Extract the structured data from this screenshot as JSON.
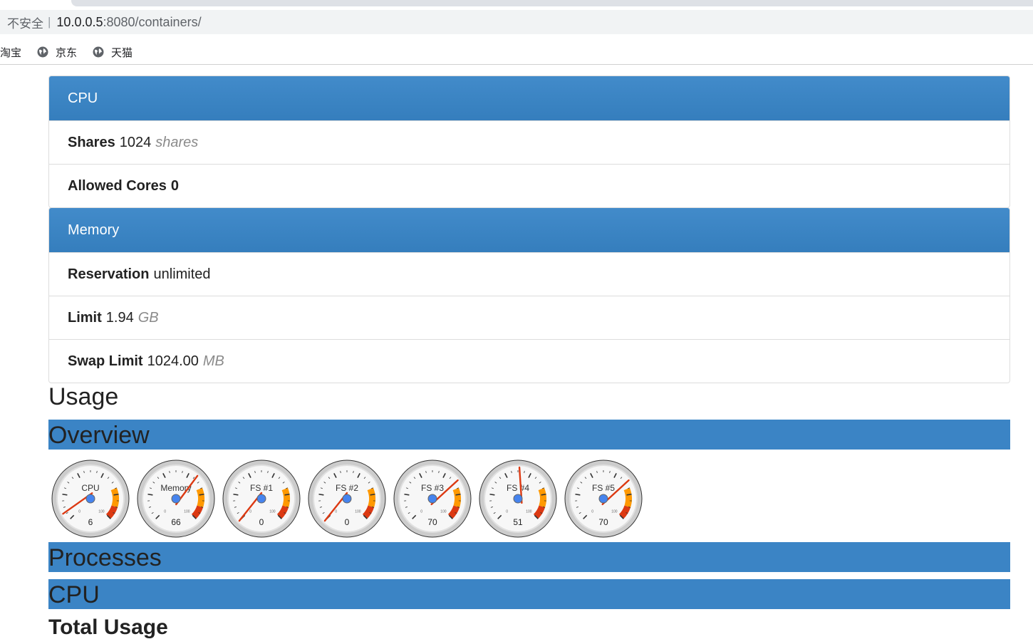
{
  "browser": {
    "security_label": "不安全",
    "url_host": "10.0.0.5",
    "url_path": ":8080/containers/",
    "bookmarks": [
      "淘宝",
      "京东",
      "天猫"
    ]
  },
  "cpu_panel": {
    "title": "CPU",
    "shares_label": "Shares",
    "shares_value": "1024",
    "shares_unit": "shares",
    "allowed_cores_label": "Allowed Cores",
    "allowed_cores_value": "0"
  },
  "memory_panel": {
    "title": "Memory",
    "reservation_label": "Reservation",
    "reservation_value": "unlimited",
    "limit_label": "Limit",
    "limit_value": "1.94",
    "limit_unit": "GB",
    "swap_label": "Swap Limit",
    "swap_value": "1024.00",
    "swap_unit": "MB"
  },
  "usage": {
    "title": "Usage",
    "overview_title": "Overview",
    "processes_title": "Processes",
    "cpu_title": "CPU",
    "total_usage_title": "Total Usage"
  },
  "gauges": [
    {
      "label": "CPU",
      "value": 6
    },
    {
      "label": "Memory",
      "value": 66
    },
    {
      "label": "FS #1",
      "value": 0
    },
    {
      "label": "FS #2",
      "value": 0
    },
    {
      "label": "FS #3",
      "value": 70
    },
    {
      "label": "FS #4",
      "value": 51
    },
    {
      "label": "FS #5",
      "value": 70
    }
  ],
  "gauge_scale": {
    "min_label": "0",
    "max_label": "100",
    "min": 0,
    "max": 100
  },
  "colors": {
    "panel_heading": "#3b84c5",
    "gauge_warn": "#ff9900",
    "gauge_danger": "#dc3912",
    "gauge_needle": "#dc3912",
    "gauge_hub": "#4684ee"
  }
}
